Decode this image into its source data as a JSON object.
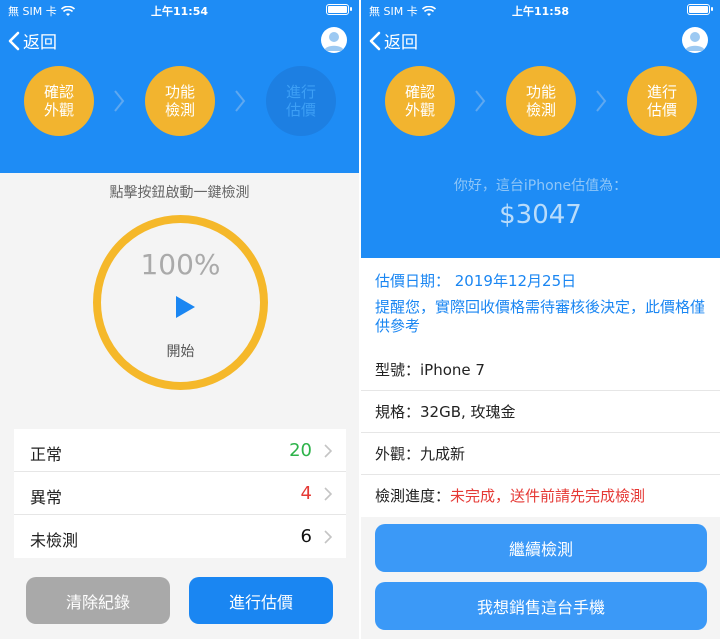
{
  "status_bar": {
    "carrier": "無 SIM 卡",
    "time_left": "上午11:54",
    "time_right": "上午11:58"
  },
  "nav": {
    "back_label": "返回"
  },
  "steps": [
    {
      "label_line1": "確認",
      "label_line2": "外觀"
    },
    {
      "label_line1": "功能",
      "label_line2": "檢測"
    },
    {
      "label_line1": "進行",
      "label_line2": "估價"
    }
  ],
  "left": {
    "hint": "點擊按鈕啟動一鍵檢測",
    "progress_percent": "100%",
    "start_label": "開始",
    "results": [
      {
        "label": "正常",
        "value": "20",
        "color": "#2db34a"
      },
      {
        "label": "異常",
        "value": "4",
        "color": "#e53935"
      },
      {
        "label": "未檢測",
        "value": "6",
        "color": "#111111"
      }
    ],
    "clear_button": "清除紀錄",
    "estimate_button": "進行估價"
  },
  "right": {
    "greeting": "你好，這台iPhone估值為：",
    "price": "$3047",
    "date_label": "估價日期： 2019年12月25日",
    "note": "提醒您，實際回收價格需待審核後決定，此價格僅供參考",
    "specs": {
      "model_label": "型號：",
      "model_value": "iPhone 7",
      "capacity_label": "規格：",
      "capacity_value": "32GB, 玫瑰金",
      "appearance_label": "外觀：",
      "appearance_value": "九成新",
      "progress_label": "檢測進度：",
      "progress_value": "未完成，送件前請先完成檢測"
    },
    "continue_button": "繼續檢測",
    "sell_button": "我想銷售這台手機"
  },
  "colors": {
    "brand_blue": "#1e8cf5",
    "step_done": "#f2b42f",
    "ring": "#f5b82a",
    "warning": "#e53935"
  }
}
